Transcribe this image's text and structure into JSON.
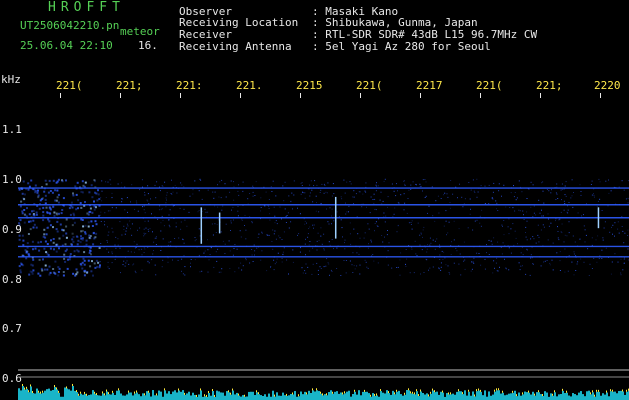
{
  "header": {
    "title": "HROFFT",
    "filename": "UT2506042210.pn",
    "meteor_label": "meteor",
    "datetime": "25.06.04 22:10",
    "minute_index": "16."
  },
  "info": [
    {
      "label": "Observer",
      "value": ": Masaki Kano"
    },
    {
      "label": "Receiving Location",
      "value": ": Shibukawa, Gunma, Japan"
    },
    {
      "label": "Receiver",
      "value": ": RTL-SDR SDR# 43dB L15 96.7MHz CW"
    },
    {
      "label": "Receiving Antenna",
      "value": ": 5el Yagi Az 280 for Seoul"
    }
  ],
  "y_axis": {
    "unit": "kHz",
    "ticks": [
      "1.1",
      "1.0",
      "0.9",
      "0.8",
      "0.7",
      "0.6"
    ]
  },
  "x_axis": {
    "ticks": [
      "221(",
      "221;",
      "221:",
      "221.",
      "2215",
      "221(",
      "2217",
      "221(",
      "221;",
      "2220"
    ]
  },
  "colors": {
    "background": "#000000",
    "signal": "#2f5cff",
    "signal_bright": "#9fd0ff",
    "power_trace": "#ffea3a",
    "power_fill": "#19b4c8",
    "label_green": "#55d055",
    "tick_yellow": "#ffe84a"
  },
  "spectrogram": {
    "horizontal_lines_khz": [
      0.987,
      0.955,
      0.93,
      0.875,
      0.855
    ],
    "meteor_burst_minute_fraction": [
      0.0,
      0.1
    ],
    "freq_range_khz": [
      0.58,
      1.16
    ]
  }
}
